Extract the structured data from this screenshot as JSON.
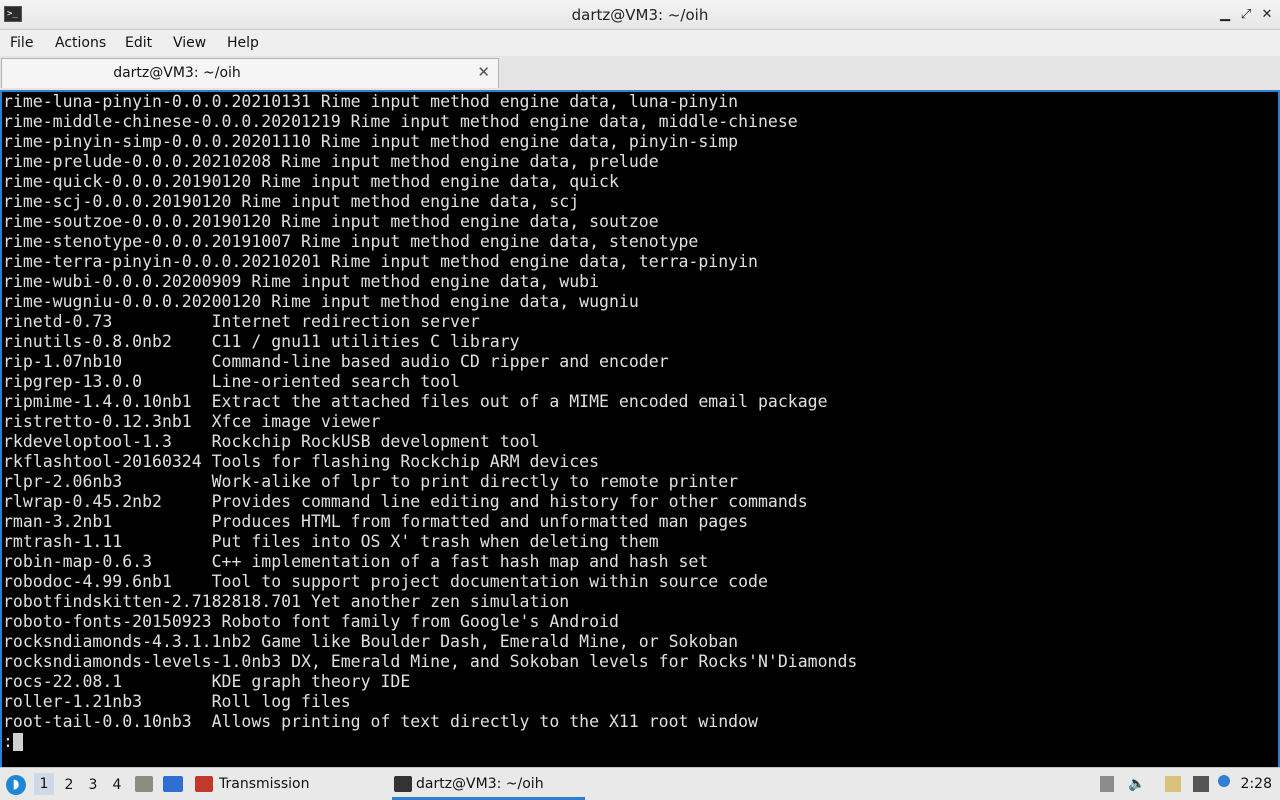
{
  "window": {
    "title": "dartz@VM3: ~/oih",
    "controls": {
      "minimize": "▁",
      "maximize": "⤢",
      "close": "✕"
    }
  },
  "menubar": {
    "items": [
      "File",
      "Actions",
      "Edit",
      "View",
      "Help"
    ]
  },
  "tabs": [
    {
      "label": "dartz@VM3: ~/oih",
      "close": "✕"
    }
  ],
  "terminal": {
    "lines": [
      "rime-luna-pinyin-0.0.0.20210131 Rime input method engine data, luna-pinyin",
      "rime-middle-chinese-0.0.0.20201219 Rime input method engine data, middle-chinese",
      "rime-pinyin-simp-0.0.0.20201110 Rime input method engine data, pinyin-simp",
      "rime-prelude-0.0.0.20210208 Rime input method engine data, prelude",
      "rime-quick-0.0.0.20190120 Rime input method engine data, quick",
      "rime-scj-0.0.0.20190120 Rime input method engine data, scj",
      "rime-soutzoe-0.0.0.20190120 Rime input method engine data, soutzoe",
      "rime-stenotype-0.0.0.20191007 Rime input method engine data, stenotype",
      "rime-terra-pinyin-0.0.0.20210201 Rime input method engine data, terra-pinyin",
      "rime-wubi-0.0.0.20200909 Rime input method engine data, wubi",
      "rime-wugniu-0.0.0.20200120 Rime input method engine data, wugniu",
      "rinetd-0.73          Internet redirection server",
      "rinutils-0.8.0nb2    C11 / gnu11 utilities C library",
      "rip-1.07nb10         Command-line based audio CD ripper and encoder",
      "ripgrep-13.0.0       Line-oriented search tool",
      "ripmime-1.4.0.10nb1  Extract the attached files out of a MIME encoded email package",
      "ristretto-0.12.3nb1  Xfce image viewer",
      "rkdeveloptool-1.3    Rockchip RockUSB development tool",
      "rkflashtool-20160324 Tools for flashing Rockchip ARM devices",
      "rlpr-2.06nb3         Work-alike of lpr to print directly to remote printer",
      "rlwrap-0.45.2nb2     Provides command line editing and history for other commands",
      "rman-3.2nb1          Produces HTML from formatted and unformatted man pages",
      "rmtrash-1.11         Put files into OS X' trash when deleting them",
      "robin-map-0.6.3      C++ implementation of a fast hash map and hash set",
      "robodoc-4.99.6nb1    Tool to support project documentation within source code",
      "robotfindskitten-2.7182818.701 Yet another zen simulation",
      "roboto-fonts-20150923 Roboto font family from Google's Android",
      "rocksndiamonds-4.3.1.1nb2 Game like Boulder Dash, Emerald Mine, or Sokoban",
      "rocksndiamonds-levels-1.0nb3 DX, Emerald Mine, and Sokoban levels for Rocks'N'Diamonds",
      "rocs-22.08.1         KDE graph theory IDE",
      "roller-1.21nb3       Roll log files",
      "root-tail-0.0.10nb3  Allows printing of text directly to the X11 root window"
    ],
    "prompt": ":"
  },
  "taskbar": {
    "workspaces": [
      "1",
      "2",
      "3",
      "4"
    ],
    "active_workspace": "1",
    "tasks": [
      {
        "label": "Transmission",
        "icon": "transmission-icon"
      },
      {
        "label": "dartz@VM3: ~/oih",
        "icon": "terminal-icon"
      }
    ],
    "clock": "2:28"
  }
}
